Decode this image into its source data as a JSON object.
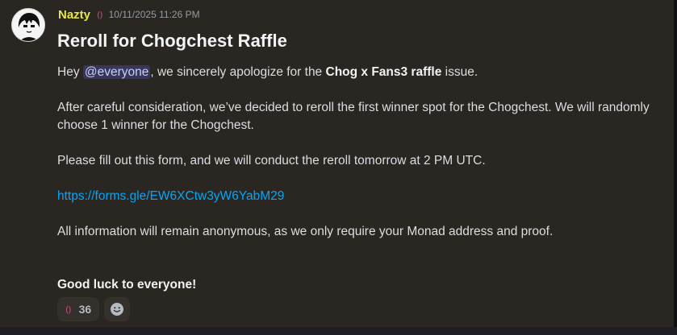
{
  "message": {
    "author": "Nazty",
    "role_icon": "()",
    "timestamp": "10/11/2025 11:26 PM",
    "title": "Reroll for Chogchest Raffle",
    "line1": {
      "prefix": "Hey ",
      "mention": "@everyone",
      "middle": ", we sincerely apologize for the ",
      "bold": "Chog x Fans3 raffle",
      "suffix": " issue."
    },
    "para2": "After careful consideration, we’ve decided to reroll the first winner spot for the Chogchest. We will randomly choose 1 winner for the Chogchest.",
    "para3": "Please fill out this form, and we will conduct the reroll tomorrow at 2 PM UTC.",
    "link": "https://forms.gle/EW6XCtw3yW6YabM29",
    "para4": "All information will remain anonymous, as we only require your Monad address and proof.",
    "closing": "Good luck to everyone!"
  },
  "reactions": [
    {
      "emoji": "()",
      "count": "36"
    }
  ],
  "add_reaction": {
    "icon": "add-reaction-icon"
  },
  "colors": {
    "username": "#e6e64a",
    "link": "#00a8fc",
    "mention_bg": "#5865f2",
    "panel_bg": "#2a2622"
  }
}
